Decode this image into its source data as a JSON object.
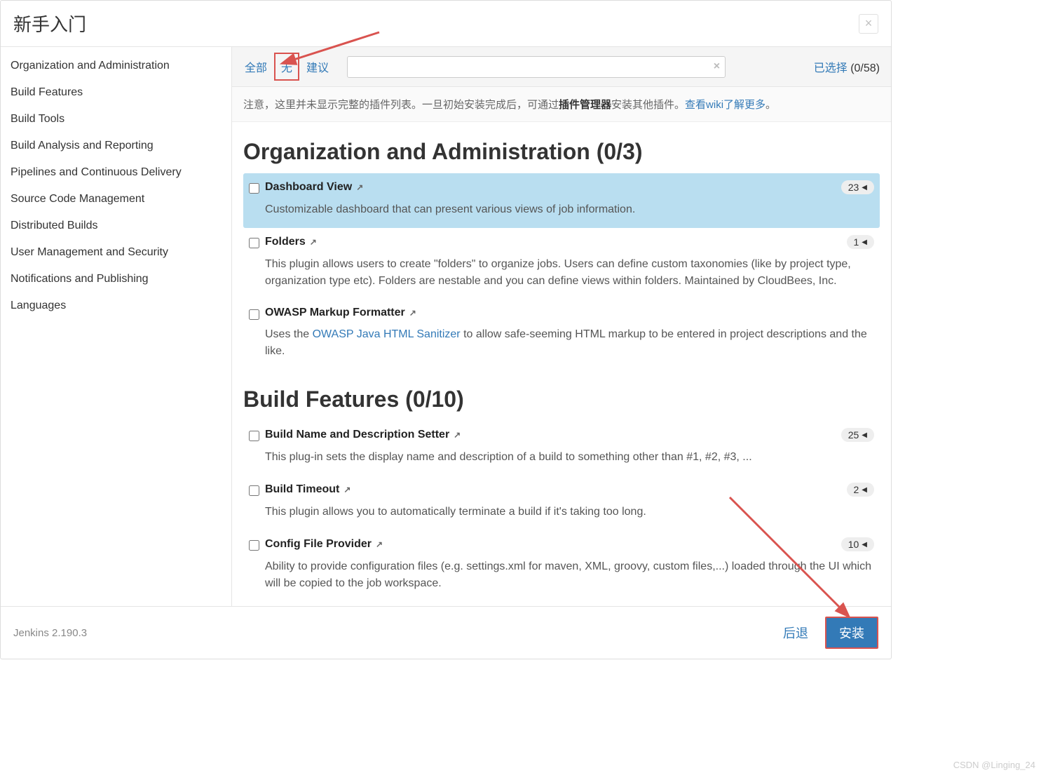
{
  "header": {
    "title": "新手入门"
  },
  "sidebar": {
    "items": [
      "Organization and Administration",
      "Build Features",
      "Build Tools",
      "Build Analysis and Reporting",
      "Pipelines and Continuous Delivery",
      "Source Code Management",
      "Distributed Builds",
      "User Management and Security",
      "Notifications and Publishing",
      "Languages"
    ]
  },
  "toolbar": {
    "tabs": {
      "all": "全部",
      "none": "无",
      "suggested": "建议"
    },
    "selected_label": "已选择",
    "selected_count": "(0/58)"
  },
  "notice": {
    "prefix": "注意，这里并未显示完整的插件列表。一旦初始安装完成后，可通过",
    "bold": "插件管理器",
    "mid": "安装其他插件。",
    "link": "查看wiki了解更多",
    "suffix": "。"
  },
  "sections": [
    {
      "title": "Organization and Administration (0/3)",
      "plugins": [
        {
          "name": "Dashboard View",
          "desc": "Customizable dashboard that can present various views of job information.",
          "badge": "23",
          "highlight": true
        },
        {
          "name": "Folders",
          "desc": "This plugin allows users to create \"folders\" to organize jobs. Users can define custom taxonomies (like by project type, organization type etc). Folders are nestable and you can define views within folders. Maintained by CloudBees, Inc.",
          "badge": "1"
        },
        {
          "name": "OWASP Markup Formatter",
          "desc_pre": "Uses the ",
          "desc_link": "OWASP Java HTML Sanitizer",
          "desc_post": " to allow safe-seeming HTML markup to be entered in project descriptions and the like."
        }
      ]
    },
    {
      "title": "Build Features (0/10)",
      "plugins": [
        {
          "name": "Build Name and Description Setter",
          "desc": "This plug-in sets the display name and description of a build to something other than #1, #2, #3, ...",
          "badge": "25"
        },
        {
          "name": "Build Timeout",
          "desc": "This plugin allows you to automatically terminate a build if it's taking too long.",
          "badge": "2"
        },
        {
          "name": "Config File Provider",
          "desc": "Ability to provide configuration files (e.g. settings.xml for maven, XML, groovy, custom files,...) loaded through the UI which will be copied to the job workspace.",
          "badge": "10"
        }
      ]
    }
  ],
  "footer": {
    "version": "Jenkins 2.190.3",
    "back": "后退",
    "install": "安装"
  },
  "watermark": "CSDN @Linging_24"
}
